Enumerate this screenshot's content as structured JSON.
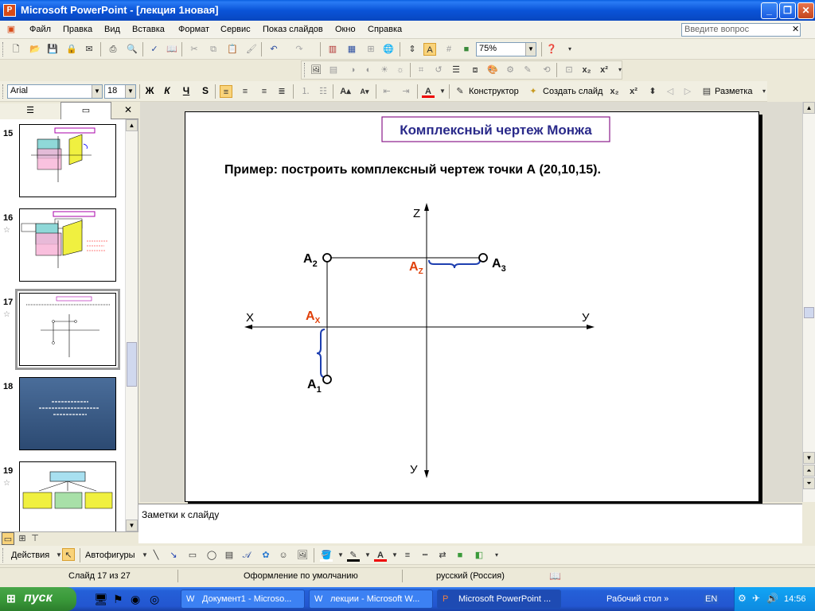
{
  "window": {
    "title": "Microsoft PowerPoint - [лекция 1новая]",
    "app_icon": "powerpoint-icon"
  },
  "menu": {
    "items": [
      "Файл",
      "Правка",
      "Вид",
      "Вставка",
      "Формат",
      "Сервис",
      "Показ слайдов",
      "Окно",
      "Справка"
    ],
    "ask_placeholder": "Введите вопрос"
  },
  "toolbar_standard": {
    "zoom": "75%"
  },
  "toolbar_format": {
    "font": "Arial",
    "size": "18",
    "bold": "Ж",
    "italic": "К",
    "underline": "Ч",
    "shadow": "S",
    "designer": "Конструктор",
    "new_slide": "Создать слайд",
    "layout": "Разметка"
  },
  "left_pane": {
    "slides": [
      {
        "num": "15"
      },
      {
        "num": "16"
      },
      {
        "num": "17",
        "selected": true
      },
      {
        "num": "18"
      },
      {
        "num": "19"
      }
    ]
  },
  "slide": {
    "title": "Комплексный чертеж Монжа",
    "subtitle": "Пример:  построить комплексный чертеж точки А (20,10,15).",
    "labels": {
      "z": "Z",
      "x": "Х",
      "y_right": "У",
      "y_down": "У",
      "a2": "A",
      "a2_sub": "2",
      "a3": "A",
      "a3_sub": "3",
      "a1": "A",
      "a1_sub": "1",
      "ax": "A",
      "ax_sub": "X",
      "az": "A",
      "az_sub": "Z"
    },
    "colors": {
      "accent": "#e0400a",
      "brace": "#1e3fb0",
      "title_text": "#2a2a8a",
      "title_border": "#8a1a8a"
    }
  },
  "notes": {
    "placeholder": "Заметки к слайду"
  },
  "drawing": {
    "actions": "Действия",
    "autoshapes": "Автофигуры"
  },
  "status": {
    "slide": "Слайд 17 из 27",
    "design": "Оформление по умолчанию",
    "language": "русский (Россия)"
  },
  "taskbar": {
    "start": "пуск",
    "tasks": [
      "Документ1 - Microso...",
      "лекции - Microsoft W...",
      "Microsoft PowerPoint ..."
    ],
    "desktop": "Рабочий стол",
    "lang": "EN",
    "time": "14:56"
  }
}
